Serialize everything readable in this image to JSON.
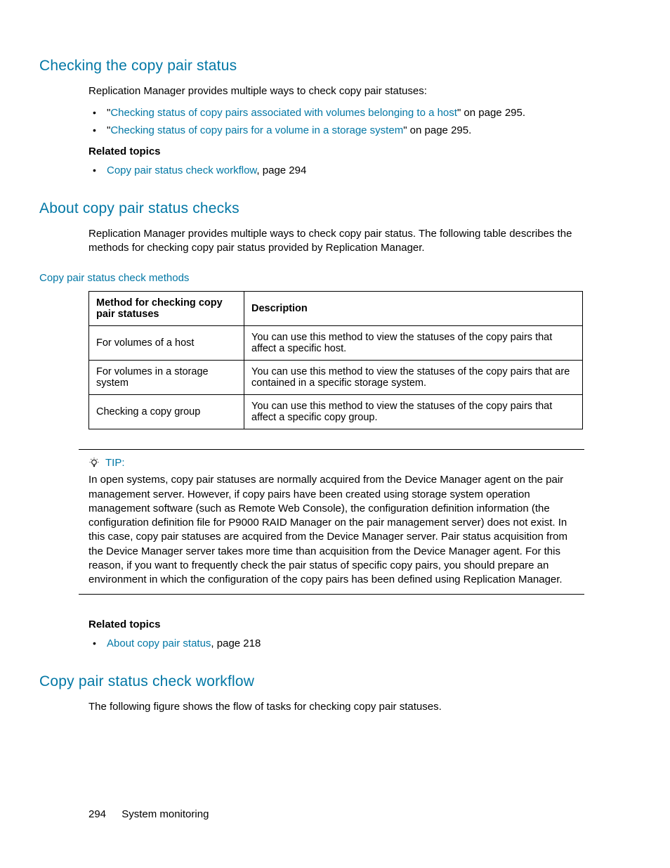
{
  "section1": {
    "heading": "Checking the copy pair status",
    "intro": "Replication Manager provides multiple ways to check copy pair statuses:",
    "bullets": [
      {
        "pre": "\"",
        "link": "Checking status of copy pairs associated with volumes belonging to a host",
        "post": "\" on page 295."
      },
      {
        "pre": "\"",
        "link": "Checking status of copy pairs for a volume in a storage system",
        "post": "\" on page 295."
      }
    ],
    "related_label": "Related topics",
    "related_items": [
      {
        "link": "Copy pair status check workflow",
        "post": ", page 294"
      }
    ]
  },
  "section2": {
    "heading": "About copy pair status checks",
    "intro": "Replication Manager provides multiple ways to check copy pair status. The following table describes the methods for checking copy pair status provided by Replication Manager.",
    "table_caption": "Copy pair status check methods",
    "table": {
      "headers": [
        "Method for checking copy pair statuses",
        "Description"
      ],
      "rows": [
        [
          "For volumes of a host",
          "You can use this method to view the statuses of the copy pairs that affect a specific host."
        ],
        [
          "For volumes in a storage system",
          "You can use this method to view the statuses of the copy pairs that are contained in a specific storage system."
        ],
        [
          "Checking a copy group",
          "You can use this method to view the statuses of the copy pairs that affect a specific copy group."
        ]
      ]
    },
    "tip_label": "TIP:",
    "tip_text": "In open systems, copy pair statuses are normally acquired from the Device Manager agent on the pair management server. However, if copy pairs have been created using storage system operation management software (such as Remote Web Console), the configuration definition information (the configuration definition file for P9000 RAID Manager on the pair management server) does not exist. In this case, copy pair statuses are acquired from the Device Manager server. Pair status acquisition from the Device Manager server takes more time than acquisition from the Device Manager agent. For this reason, if you want to frequently check the pair status of specific copy pairs, you should prepare an environment in which the configuration of the copy pairs has been defined using Replication Manager.",
    "related_label": "Related topics",
    "related_items": [
      {
        "link": "About copy pair status",
        "post": ", page 218"
      }
    ]
  },
  "section3": {
    "heading": "Copy pair status check workflow",
    "intro": "The following figure shows the flow of tasks for checking copy pair statuses."
  },
  "footer": {
    "page_number": "294",
    "chapter": "System monitoring"
  }
}
